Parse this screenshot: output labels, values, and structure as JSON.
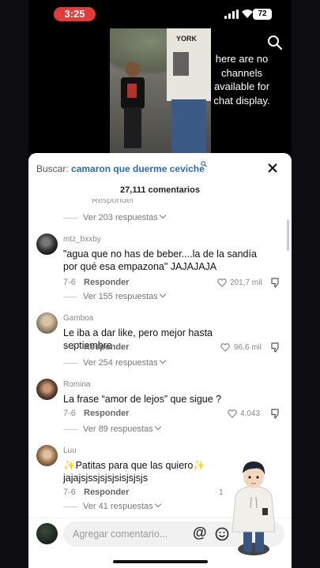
{
  "status": {
    "time": "3:25",
    "battery": "72"
  },
  "video": {
    "overlay_text": "here are no channels available for chat display.",
    "shirt_text": "YORK"
  },
  "sheet": {
    "search_label": "Buscar: ",
    "search_query": "camaron que duerme ceviche",
    "comment_count": "27,111 comentarios",
    "clipped_text": "Responder"
  },
  "comments": [
    {
      "replies": "Ver 203 respuestas"
    },
    {
      "user": "mtz_bxxby",
      "text": "\"agua que no has de beber....la de la sandía por qué esa empazona\" JAJAJAJA",
      "date": "7-6",
      "reply": "Responder",
      "likes": "201,7 mil",
      "replies": "Ver 155 respuestas"
    },
    {
      "user": "Gamboa",
      "text": "Le iba a dar like, pero mejor hasta septiembre",
      "date": "7-7",
      "reply": "Responder",
      "likes": "96.6 mil",
      "replies": "Ver 254 respuestas"
    },
    {
      "user": "Romina",
      "text": "La frase “amor de lejos” que sigue ?",
      "date": "7-6",
      "reply": "Responder",
      "likes": "4,043",
      "replies": "Ver 89 respuestas"
    },
    {
      "user": "Luu",
      "text": "✨Patitas para que las quiero✨ jajajsjssjsjsjsisjsjsjs",
      "date": "7-6",
      "reply": "Responder",
      "likes": "1",
      "replies": "Ver 41 respuestas"
    }
  ],
  "input": {
    "placeholder": "Agregar comentario...",
    "at": "@"
  },
  "colors": {
    "time_pill": "#e23b3b",
    "link": "#2b6cb0"
  }
}
